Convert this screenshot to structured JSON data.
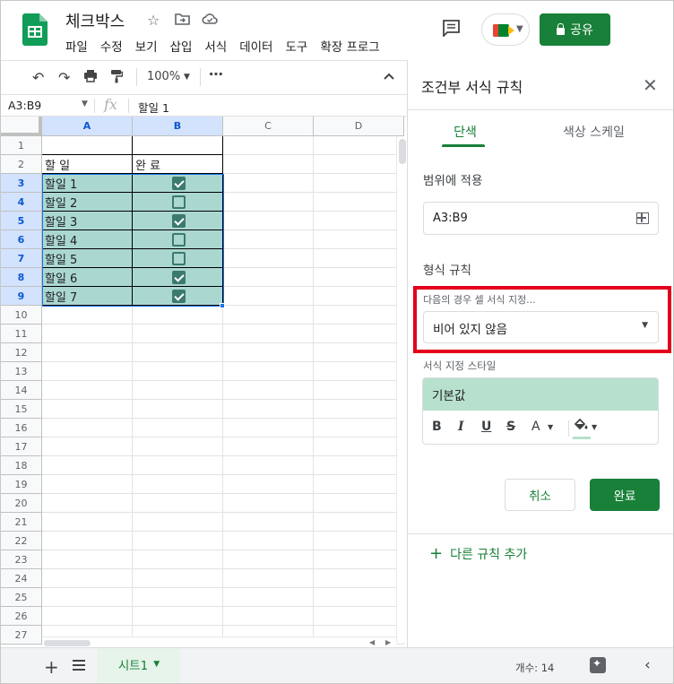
{
  "header": {
    "doc_title": "체크박스",
    "share_label": "공유",
    "menu": [
      "파일",
      "수정",
      "보기",
      "삽입",
      "서식",
      "데이터",
      "도구",
      "확장 프로그"
    ]
  },
  "toolbar": {
    "zoom": "100%"
  },
  "formula_bar": {
    "namebox": "A3:B9",
    "fx": "fx",
    "content": "할일 1"
  },
  "grid": {
    "columns": [
      "A",
      "B",
      "C",
      "D"
    ],
    "rows": [
      "1",
      "2",
      "3",
      "4",
      "5",
      "6",
      "7",
      "8",
      "9",
      "10",
      "11",
      "12",
      "13",
      "14",
      "15",
      "16",
      "17",
      "18",
      "19",
      "20",
      "21",
      "22",
      "23",
      "24",
      "25",
      "26",
      "27"
    ],
    "header_row": {
      "a": "할 일",
      "b": "완 료"
    },
    "tasks": [
      {
        "label": "할일 1",
        "checked": true
      },
      {
        "label": "할일 2",
        "checked": false
      },
      {
        "label": "할일 3",
        "checked": true
      },
      {
        "label": "할일 4",
        "checked": false
      },
      {
        "label": "할일 5",
        "checked": false
      },
      {
        "label": "할일 6",
        "checked": true
      },
      {
        "label": "할일 7",
        "checked": true
      }
    ],
    "highlight_color": "#abd7d1"
  },
  "sheetbar": {
    "tab": "시트1",
    "count": "개수: 14"
  },
  "panel": {
    "title": "조건부 서식 규칙",
    "tab_single": "단색",
    "tab_scale": "색상 스케일",
    "range_label": "범위에 적용",
    "range_value": "A3:B9",
    "format_rules_label": "형식 규칙",
    "condition_label": "다음의 경우 셀 서식 지정...",
    "condition_value": "비어 있지 않음",
    "style_label": "서식 지정 스타일",
    "style_preview": "기본값",
    "cancel": "취소",
    "done": "완료",
    "add_rule": "다른 규칙 추가",
    "accent": "#188038",
    "highlight_border": "#e4001b"
  }
}
